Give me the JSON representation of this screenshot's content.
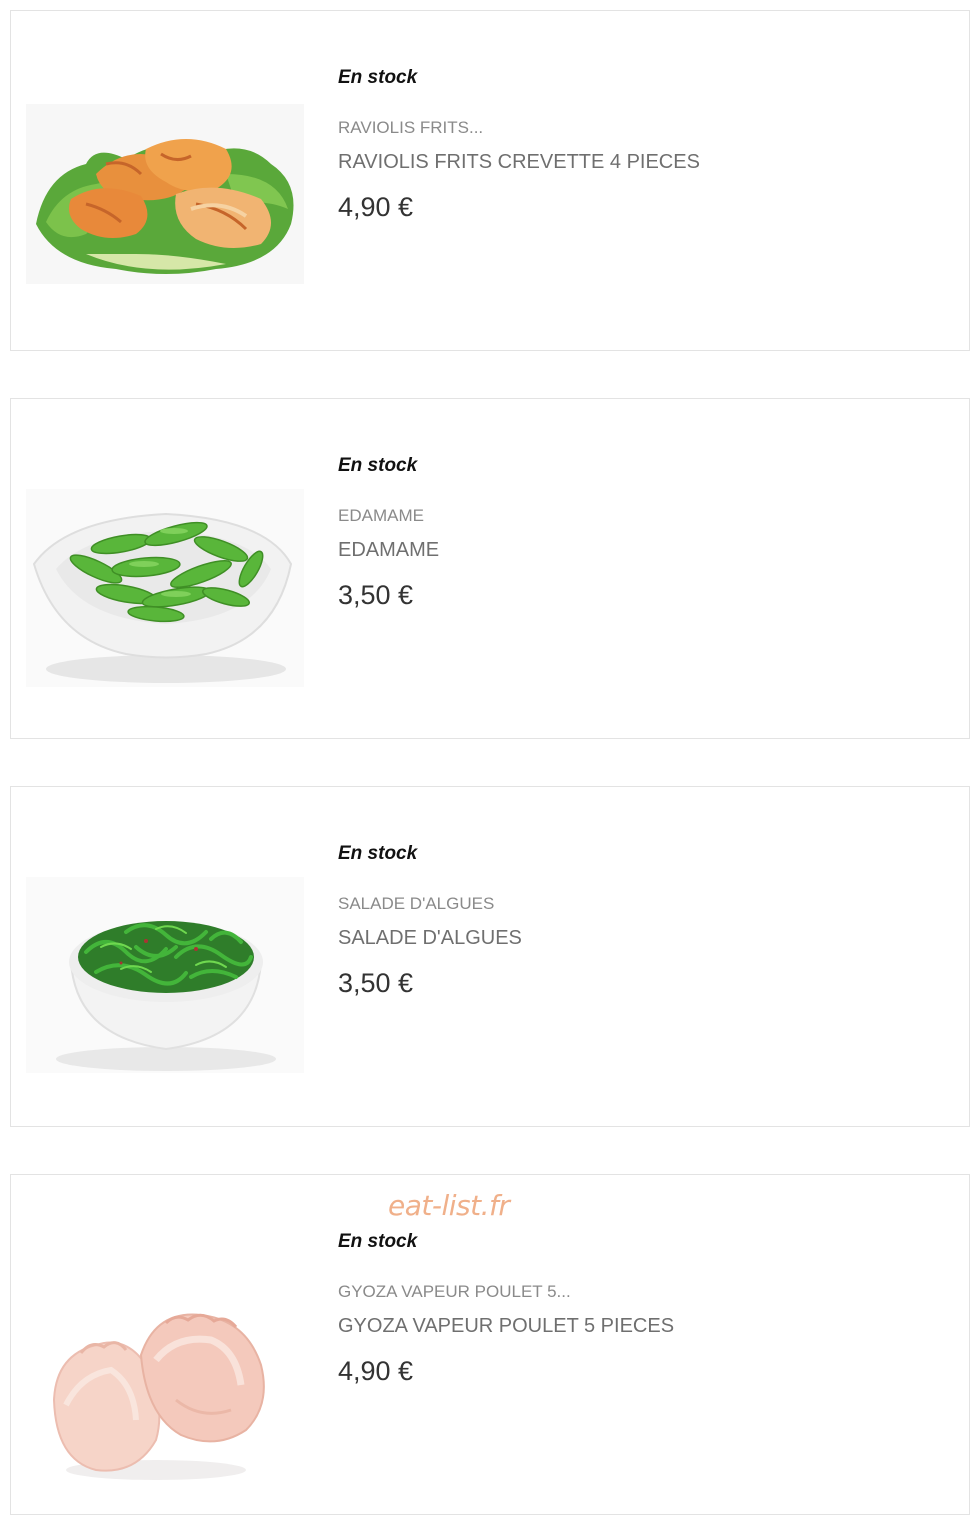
{
  "products": [
    {
      "stock": "En stock",
      "short_name": "RAVIOLIS FRITS...",
      "full_name": "RAVIOLIS FRITS CREVETTE 4 PIECES",
      "price": "4,90 €",
      "image_icon": "fried-ravioli-image"
    },
    {
      "stock": "En stock",
      "short_name": "EDAMAME",
      "full_name": "EDAMAME",
      "price": "3,50 €",
      "image_icon": "edamame-image"
    },
    {
      "stock": "En stock",
      "short_name": "SALADE D'ALGUES",
      "full_name": "SALADE D'ALGUES",
      "price": "3,50 €",
      "image_icon": "seaweed-salad-image"
    },
    {
      "stock": "En stock",
      "short_name": "GYOZA VAPEUR POULET 5...",
      "full_name": "GYOZA VAPEUR POULET 5 PIECES",
      "price": "4,90 €",
      "image_icon": "steamed-gyoza-image"
    }
  ],
  "watermark": "eat-list.fr"
}
